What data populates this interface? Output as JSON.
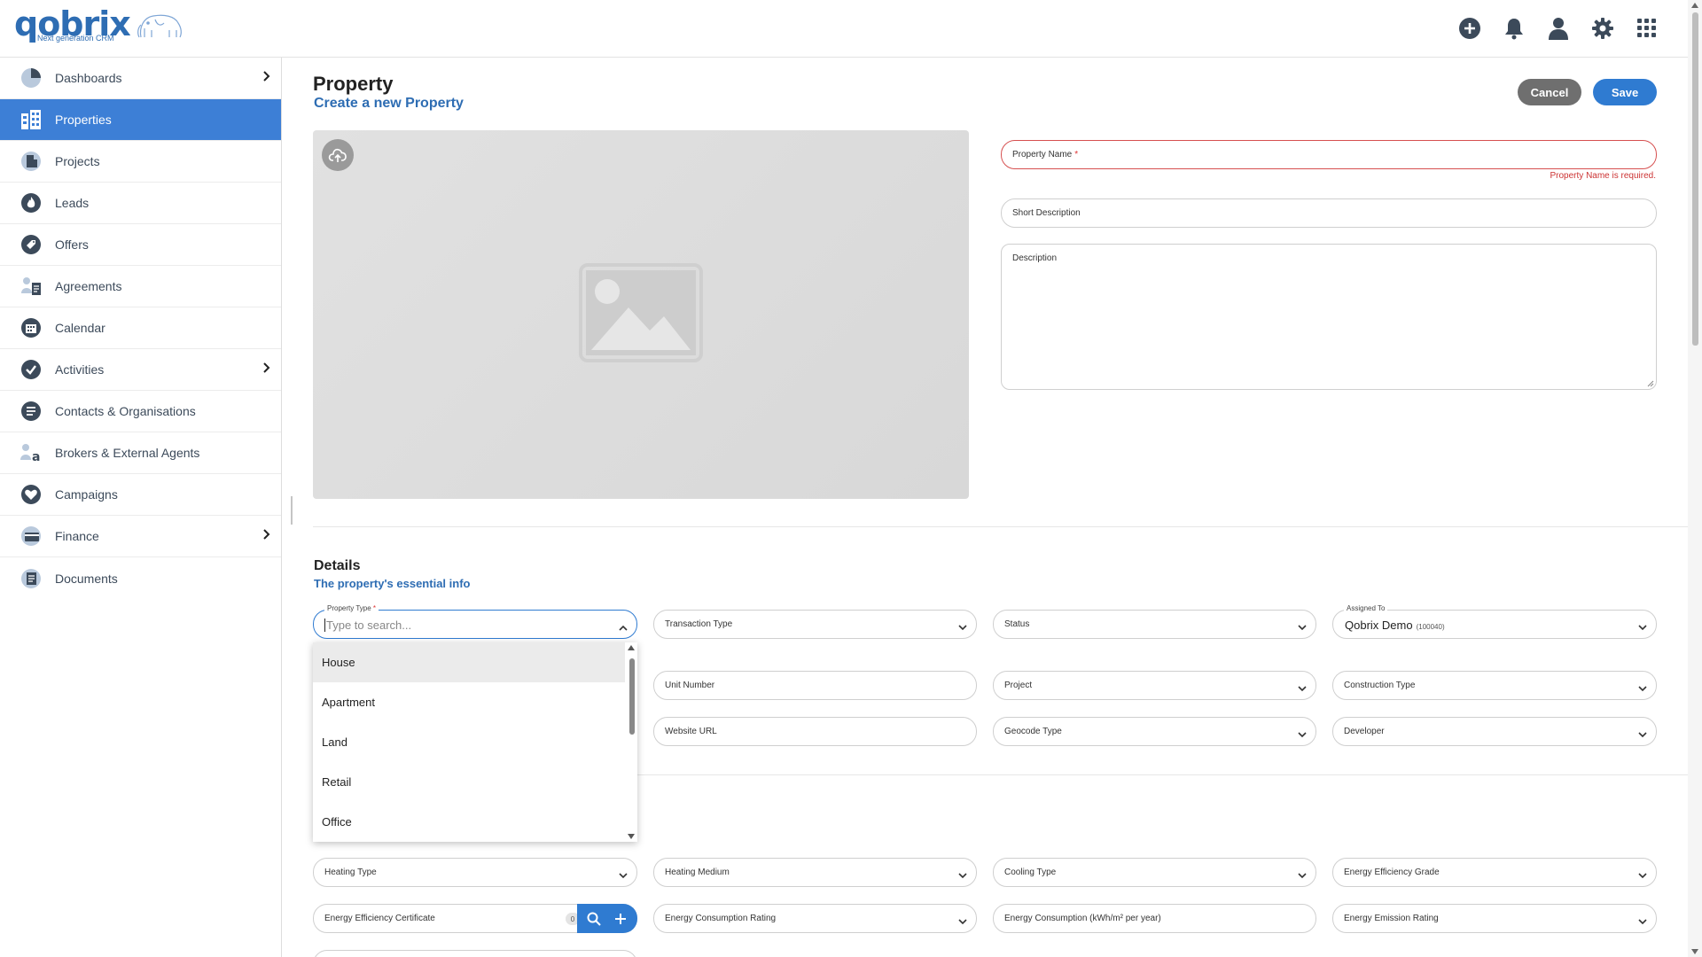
{
  "brand": {
    "name": "qobrix",
    "tagline": "Next generation CRM",
    "color": "#2e6db3"
  },
  "topbar": {
    "icons": [
      "add-circle-icon",
      "bell-icon",
      "user-icon",
      "gear-icon",
      "apps-grid-icon"
    ]
  },
  "sidebar": {
    "accent": "#3d7fd6",
    "items": [
      {
        "label": "Dashboards",
        "icon": "pie-chart-icon",
        "has_submenu": true
      },
      {
        "label": "Properties",
        "icon": "building-icon",
        "active": true
      },
      {
        "label": "Projects",
        "icon": "project-icon"
      },
      {
        "label": "Leads",
        "icon": "flame-icon"
      },
      {
        "label": "Offers",
        "icon": "tag-icon"
      },
      {
        "label": "Agreements",
        "icon": "agreement-icon"
      },
      {
        "label": "Calendar",
        "icon": "calendar-icon"
      },
      {
        "label": "Activities",
        "icon": "check-icon",
        "has_submenu": true
      },
      {
        "label": "Contacts & Organisations",
        "icon": "contacts-icon"
      },
      {
        "label": "Brokers & External Agents",
        "icon": "broker-icon"
      },
      {
        "label": "Campaigns",
        "icon": "heart-icon"
      },
      {
        "label": "Finance",
        "icon": "finance-icon",
        "has_submenu": true
      },
      {
        "label": "Documents",
        "icon": "documents-icon"
      }
    ]
  },
  "header": {
    "title": "Property",
    "subtitle": "Create a new Property",
    "cancel_label": "Cancel",
    "save_label": "Save"
  },
  "form": {
    "property_name_label": "Property Name",
    "property_name_required": "*",
    "property_name_error": "Property Name is required.",
    "short_description_label": "Short Description",
    "description_label": "Description"
  },
  "details": {
    "title": "Details",
    "subtitle": "The property's essential info",
    "property_type_label": "Property Type",
    "property_type_required": "*",
    "property_type_placeholder": "Type to search...",
    "transaction_type_label": "Transaction Type",
    "status_label": "Status",
    "assigned_to_label": "Assigned To",
    "assigned_to_value": "Qobrix Demo",
    "assigned_to_id": "(100040)",
    "unit_number_label": "Unit Number",
    "project_label": "Project",
    "construction_type_label": "Construction Type",
    "website_url_label": "Website URL",
    "geocode_type_label": "Geocode Type",
    "developer_label": "Developer",
    "property_type_options": [
      "House",
      "Apartment",
      "Land",
      "Retail",
      "Office"
    ]
  },
  "energy": {
    "heating_type_label": "Heating Type",
    "heating_medium_label": "Heating Medium",
    "cooling_type_label": "Cooling Type",
    "energy_efficiency_grade_label": "Energy Efficiency Grade",
    "energy_efficiency_certificate_label": "Energy Efficiency Certificate",
    "certificate_count": "0",
    "energy_consumption_rating_label": "Energy Consumption Rating",
    "energy_consumption_label": "Energy Consumption (kWh/m² per year)",
    "energy_emission_rating_label": "Energy Emission Rating"
  }
}
